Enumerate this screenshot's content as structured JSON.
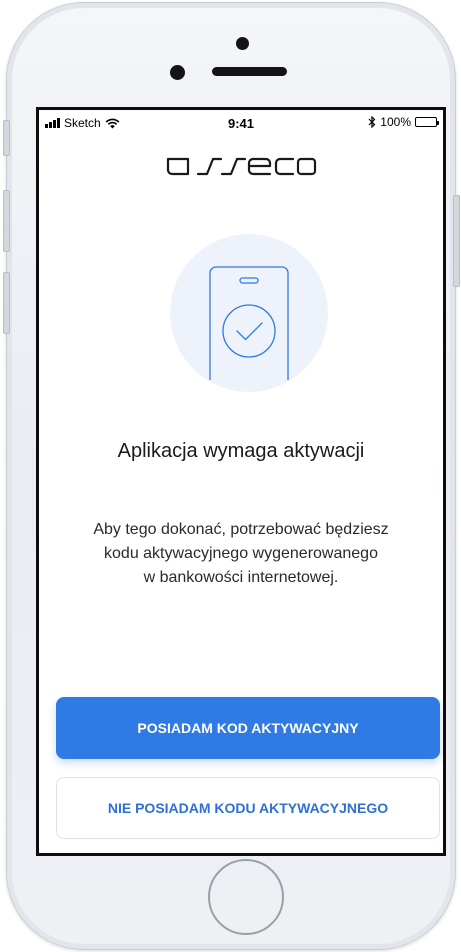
{
  "status_bar": {
    "carrier": "Sketch",
    "time": "9:41",
    "battery": "100%"
  },
  "logo": {
    "text": "asseco"
  },
  "icons": {
    "signal": "signal-bars-icon",
    "wifi": "wifi-icon",
    "bluetooth": "bluetooth-icon",
    "battery": "battery-icon",
    "phone_check": "phone-check-icon"
  },
  "content": {
    "title": "Aplikacja wymaga aktywacji",
    "description_lines": [
      "Aby tego dokonać, potrzebować będziesz",
      "kodu aktywacyjnego wygenerowanego",
      "w bankowości internetowej."
    ]
  },
  "actions": {
    "primary_label": "POSIADAM KOD AKTYWACYJNY",
    "secondary_label": "NIE POSIADAM KODU AKTYWACYJNEGO"
  },
  "colors": {
    "accent": "#2f7ae5",
    "secondary_text": "#2f6fd8",
    "illustration_bg": "#eef3fb"
  }
}
